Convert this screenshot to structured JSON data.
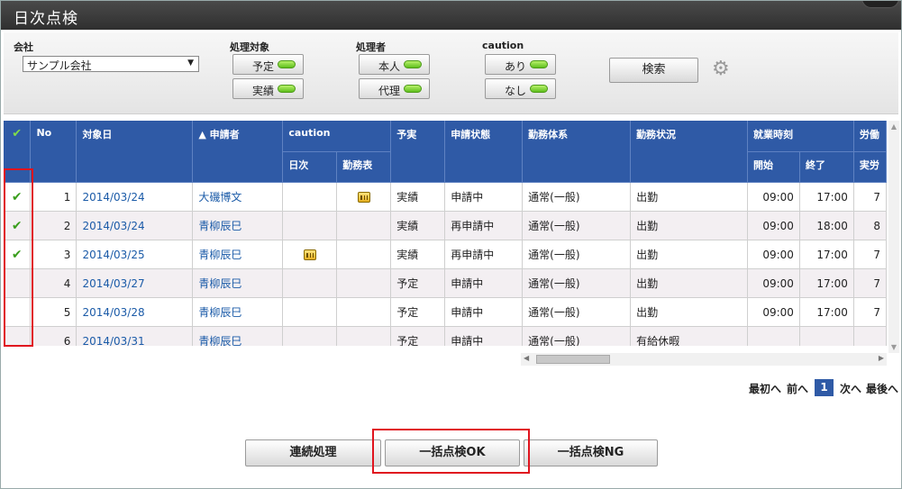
{
  "window": {
    "title": "日次点検"
  },
  "filters": {
    "company_label": "会社",
    "company_value": "サンプル会社",
    "target_label": "処理対象",
    "target_options": [
      "予定",
      "実績"
    ],
    "handler_label": "処理者",
    "handler_options": [
      "本人",
      "代理"
    ],
    "caution_label": "caution",
    "caution_options": [
      "あり",
      "なし"
    ],
    "search_label": "検索"
  },
  "table": {
    "headers": {
      "check": "✔",
      "no": "No",
      "date": "対象日",
      "applicant": "▲ 申請者",
      "caution": "caution",
      "caution_daily": "日次",
      "caution_sheet": "勤務表",
      "plan_actual": "予実",
      "status": "申請状態",
      "work_system": "勤務体系",
      "work_status": "勤務状況",
      "work_time": "就業時刻",
      "work_start": "開始",
      "work_end": "終了",
      "labor": "労働",
      "labor_actual": "実労"
    },
    "rows": [
      {
        "checked": "✔",
        "no": "1",
        "date": "2014/03/24",
        "applicant": "大磯博文",
        "plan_actual": "実績",
        "status": "申請中",
        "work_system": "通常(一般)",
        "work_status": "出勤",
        "start": "09:00",
        "end": "17:00",
        "labor": "7"
      },
      {
        "checked": "✔",
        "no": "2",
        "date": "2014/03/24",
        "applicant": "青柳辰巳",
        "plan_actual": "実績",
        "status": "再申請中",
        "work_system": "通常(一般)",
        "work_status": "出勤",
        "start": "09:00",
        "end": "18:00",
        "labor": "8"
      },
      {
        "checked": "✔",
        "no": "3",
        "date": "2014/03/25",
        "applicant": "青柳辰巳",
        "plan_actual": "実績",
        "status": "再申請中",
        "work_system": "通常(一般)",
        "work_status": "出勤",
        "start": "09:00",
        "end": "17:00",
        "labor": "7"
      },
      {
        "checked": "",
        "no": "4",
        "date": "2014/03/27",
        "applicant": "青柳辰巳",
        "plan_actual": "予定",
        "status": "申請中",
        "work_system": "通常(一般)",
        "work_status": "出勤",
        "start": "09:00",
        "end": "17:00",
        "labor": "7"
      },
      {
        "checked": "",
        "no": "5",
        "date": "2014/03/28",
        "applicant": "青柳辰巳",
        "plan_actual": "予定",
        "status": "申請中",
        "work_system": "通常(一般)",
        "work_status": "出勤",
        "start": "09:00",
        "end": "17:00",
        "labor": "7"
      },
      {
        "checked": "",
        "no": "6",
        "date": "2014/03/31",
        "applicant": "青柳辰巳",
        "plan_actual": "予定",
        "status": "申請中",
        "work_system": "通常(一般)",
        "work_status": "有給休暇",
        "start": "",
        "end": "",
        "labor": ""
      }
    ]
  },
  "pager": {
    "first": "最初へ",
    "prev": "前へ",
    "current": "1",
    "next": "次へ",
    "last": "最後へ"
  },
  "actions": {
    "sequential": "連続処理",
    "bulk_ok": "一括点検OK",
    "bulk_ng": "一括点検NG"
  },
  "colors": {
    "header_blue": "#2f5aa6",
    "led_green": "#5fbf1d",
    "highlight_red": "#e0141e",
    "check_green": "#3a9e1d"
  }
}
